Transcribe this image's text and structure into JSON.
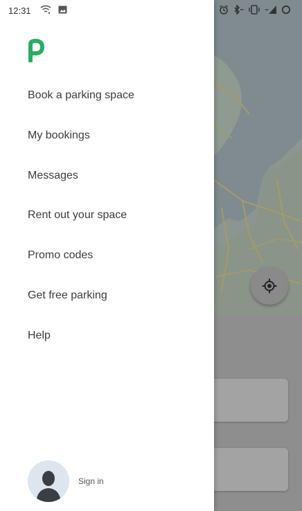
{
  "status_bar": {
    "time": "12:31",
    "left_icons": [
      "wifi-question-icon",
      "image-icon"
    ],
    "right_icons": [
      "alarm-icon",
      "bluetooth-icon",
      "vibrate-icon",
      "signal-icon",
      "battery-icon"
    ]
  },
  "drawer": {
    "logo_icon": "parking-logo-icon",
    "logo_color": "#27ae60",
    "menu": [
      {
        "label": "Book a parking space"
      },
      {
        "label": "My bookings"
      },
      {
        "label": "Messages"
      },
      {
        "label": "Rent out your space"
      },
      {
        "label": "Promo codes"
      },
      {
        "label": "Get free parking"
      },
      {
        "label": "Help"
      }
    ],
    "sign_in_label": "Sign in"
  },
  "background": {
    "locate_button_icon": "crosshair-locate-icon"
  }
}
